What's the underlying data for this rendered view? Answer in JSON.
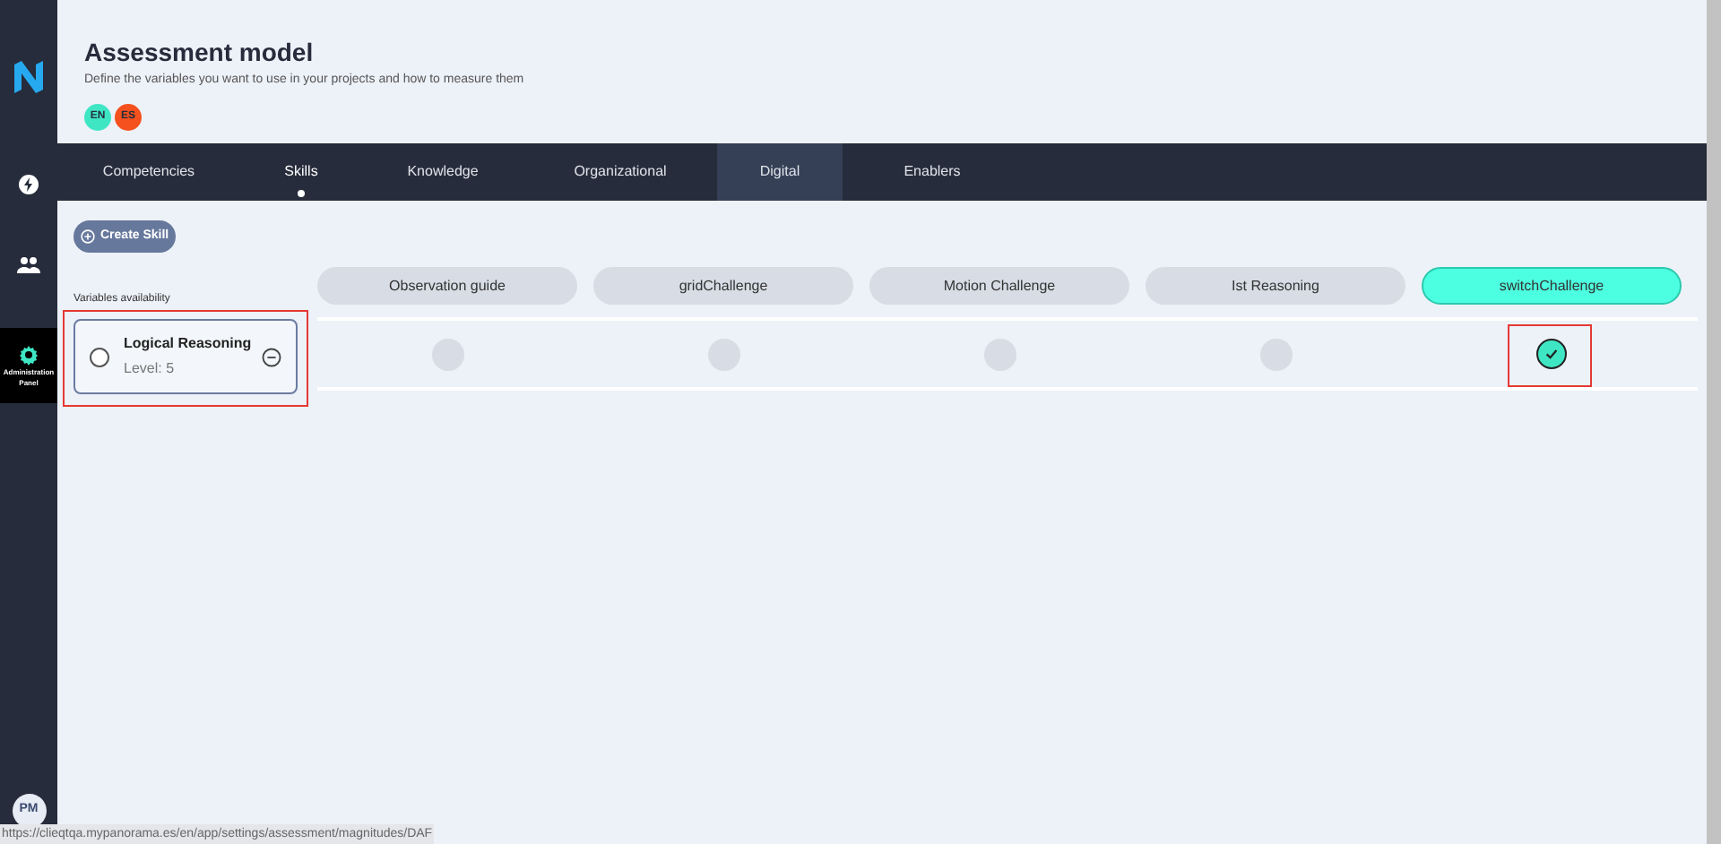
{
  "sidebar": {
    "items": [
      {
        "kind": "bolt",
        "selected": false
      },
      {
        "kind": "people",
        "selected": false
      },
      {
        "kind": "gear",
        "label": "Administration Panel",
        "selected": true
      }
    ],
    "avatar": "PM"
  },
  "header": {
    "title": "Assessment model",
    "subtitle": "Define the variables you want to use in your projects and how to measure them",
    "languages": [
      {
        "code": "EN",
        "color": "#3ee6c4"
      },
      {
        "code": "ES",
        "color": "#f4511e"
      }
    ]
  },
  "tabs": [
    {
      "label": "Competencies",
      "selected": false,
      "hovered": false
    },
    {
      "label": "Skills",
      "selected": true,
      "hovered": false
    },
    {
      "label": "Knowledge",
      "selected": false,
      "hovered": false
    },
    {
      "label": "Organizational",
      "selected": false,
      "hovered": false
    },
    {
      "label": "Digital",
      "selected": false,
      "hovered": true
    },
    {
      "label": "Enablers",
      "selected": false,
      "hovered": false
    }
  ],
  "create_button": "Create Skill",
  "variables_label": "Variables availability",
  "variable": {
    "name": "Logical Reasoning",
    "level": "Level: 5",
    "checked": false,
    "annotated": true
  },
  "columns": [
    {
      "name": "Observation guide",
      "selected": false,
      "checked": false,
      "annotated": false
    },
    {
      "name": "gridChallenge",
      "selected": false,
      "checked": false,
      "annotated": false
    },
    {
      "name": "Motion Challenge",
      "selected": false,
      "checked": false,
      "annotated": false
    },
    {
      "name": "Ist Reasoning",
      "selected": false,
      "checked": false,
      "annotated": false
    },
    {
      "name": "switchChallenge",
      "selected": true,
      "checked": true,
      "annotated": true
    }
  ],
  "status_bar": "https://clieqtqa.mypanorama.es/en/app/settings/assessment/magnitudes/DAF"
}
